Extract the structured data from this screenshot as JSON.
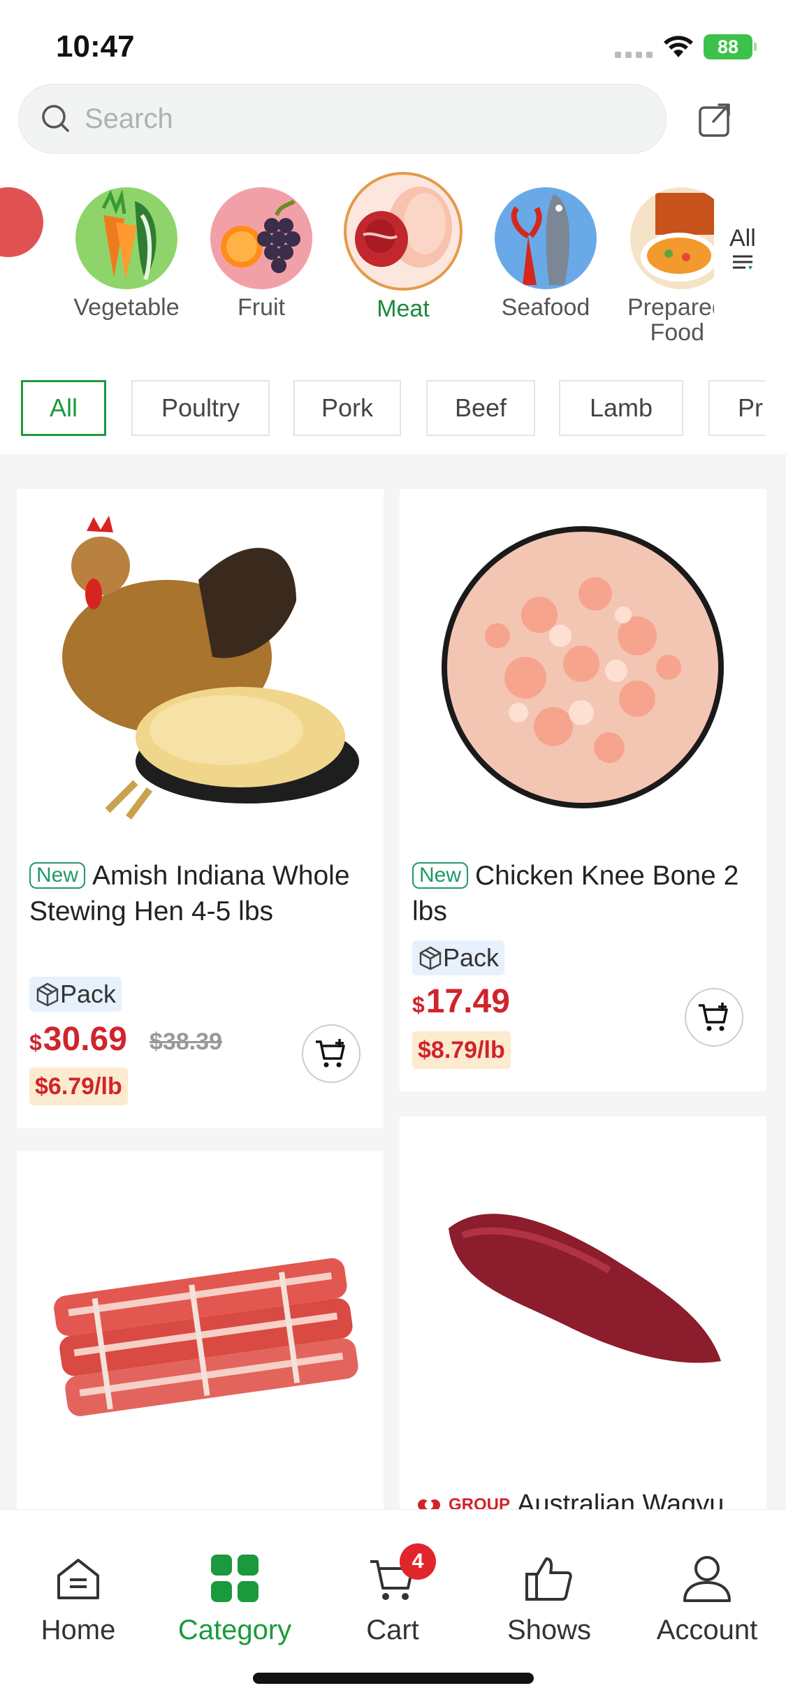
{
  "status_bar": {
    "time": "10:47",
    "battery": "88"
  },
  "search": {
    "placeholder": "Search"
  },
  "categories": [
    {
      "label": "Vegetable"
    },
    {
      "label": "Fruit"
    },
    {
      "label": "Meat",
      "selected": true
    },
    {
      "label": "Seafood"
    },
    {
      "label": "Prepared Food"
    },
    {
      "label": "All"
    }
  ],
  "subcategories": [
    "All",
    "Poultry",
    "Pork",
    "Beef",
    "Lamb",
    "Pr"
  ],
  "subcategory_selected": "All",
  "products": [
    {
      "badge": "New",
      "title": "Amish Indiana Whole Stewing Hen 4-5 lbs",
      "tag": "Pack",
      "currency": "$",
      "price": "30.69",
      "original_price": "$38.39",
      "unit_price": "$6.79/lb"
    },
    {
      "badge": "New",
      "title": "Chicken Knee Bone 2 lbs",
      "tag": "Pack",
      "currency": "$",
      "price": "17.49",
      "unit_price": "$8.79/lb"
    },
    {
      "title": ""
    },
    {
      "group_label": "GROUP",
      "title": "Australian Wagyu"
    }
  ],
  "nav": {
    "items": [
      "Home",
      "Category",
      "Cart",
      "Shows",
      "Account"
    ],
    "active": "Category",
    "cart_count": "4"
  },
  "colors": {
    "accent": "#1a9a3c",
    "price": "#d0242a",
    "badge_red": "#e0262c"
  }
}
